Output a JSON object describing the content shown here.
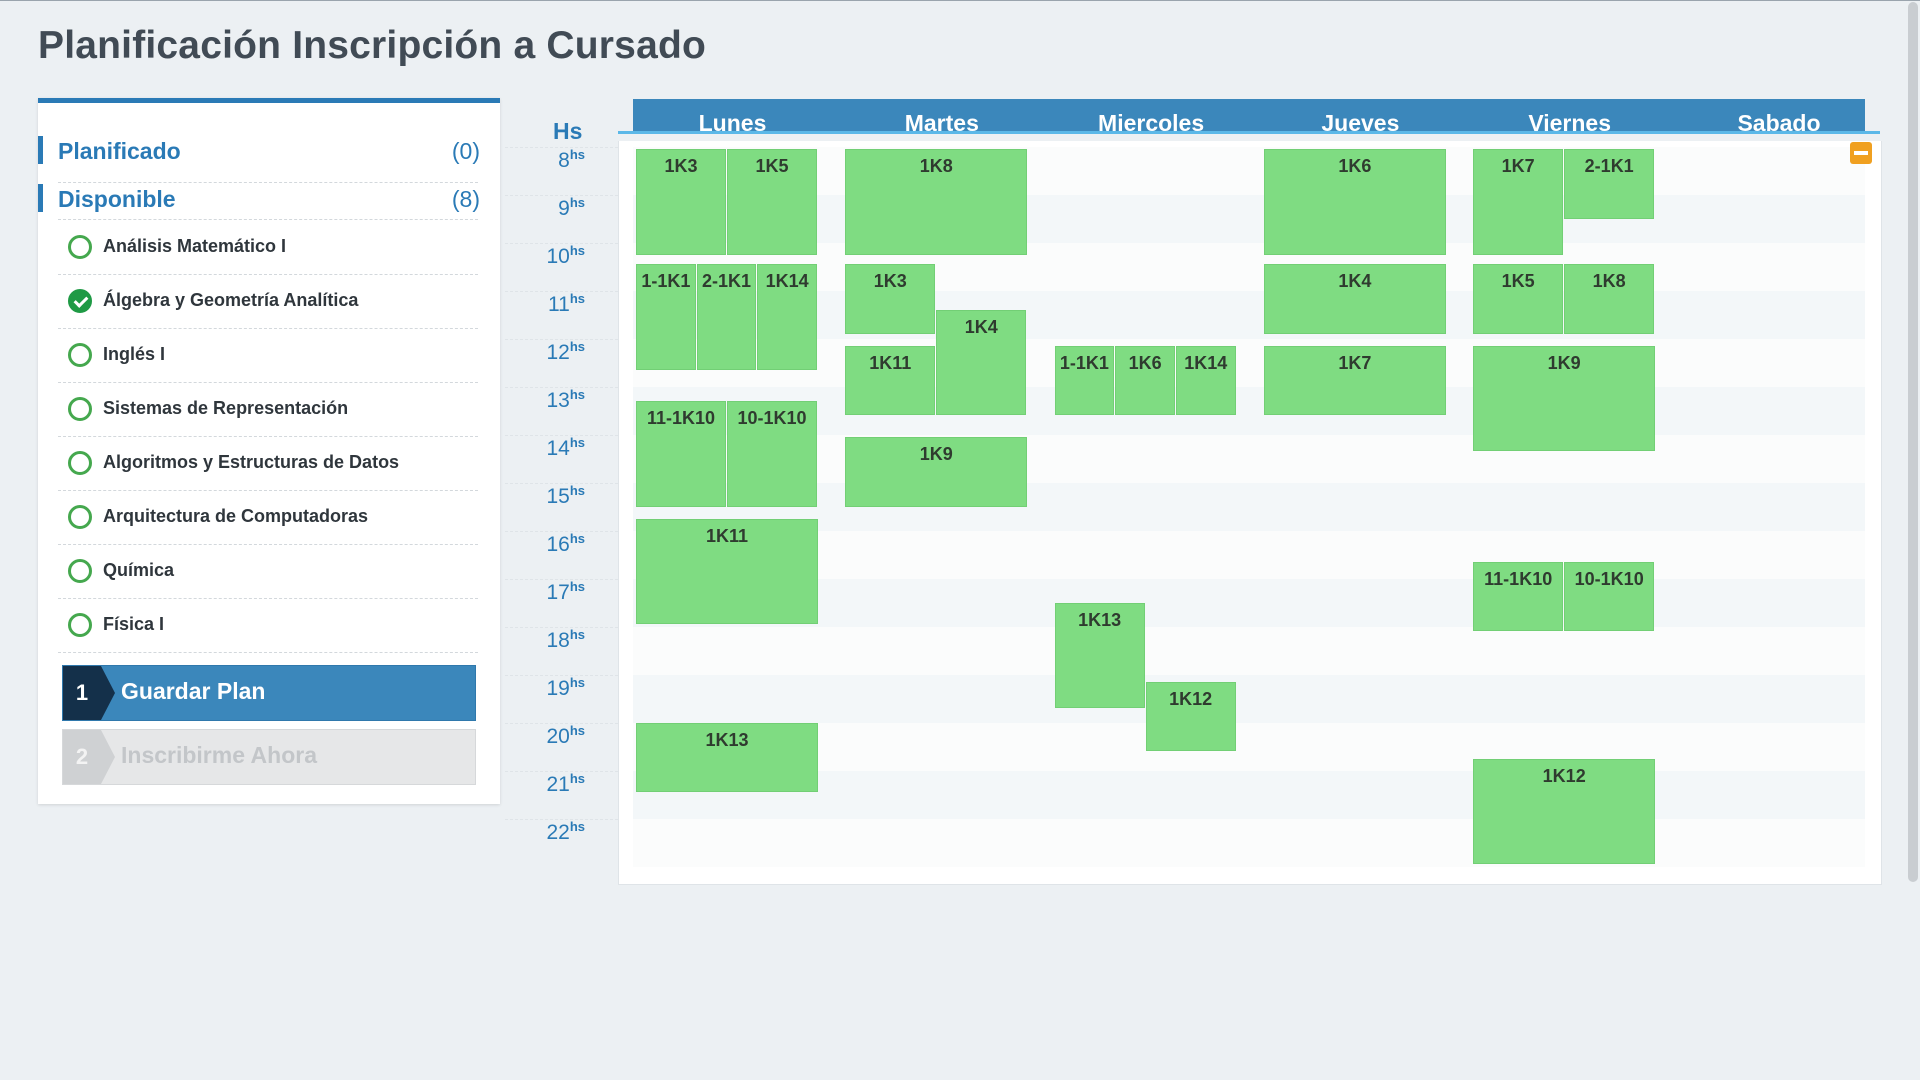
{
  "page": {
    "title": "Planificación Inscripción a Cursado"
  },
  "sidebar": {
    "planned": {
      "label": "Planificado",
      "count": "(0)"
    },
    "available": {
      "label": "Disponible",
      "count": "(8)"
    },
    "subjects": [
      {
        "label": "Análisis Matemático I",
        "checked": false
      },
      {
        "label": "Álgebra y Geometría Analítica",
        "checked": true
      },
      {
        "label": "Inglés I",
        "checked": false
      },
      {
        "label": "Sistemas de Representación",
        "checked": false
      },
      {
        "label": "Algoritmos y Estructuras de Datos",
        "checked": false
      },
      {
        "label": "Arquitectura de Computadoras",
        "checked": false
      },
      {
        "label": "Química",
        "checked": false
      },
      {
        "label": "Física I",
        "checked": false
      }
    ],
    "steps": [
      {
        "number": "1",
        "label": "Guardar Plan",
        "enabled": true
      },
      {
        "number": "2",
        "label": "Inscribirme Ahora",
        "enabled": false
      }
    ]
  },
  "calendar": {
    "hours_label": "Hs",
    "hour_suffix": "hs",
    "days": [
      "Lunes",
      "Martes",
      "Miercoles",
      "Jueves",
      "Viernes",
      "Sabado"
    ],
    "hours": [
      "8",
      "9",
      "10",
      "11",
      "12",
      "13",
      "14",
      "15",
      "16",
      "17",
      "18",
      "19",
      "20",
      "21",
      "22"
    ],
    "blocks": [
      {
        "label": "1K3",
        "day": "Lunes",
        "start": 8,
        "end": 10.2,
        "col": 0,
        "cols": 2
      },
      {
        "label": "1K5",
        "day": "Lunes",
        "start": 8,
        "end": 10.2,
        "col": 1,
        "cols": 2
      },
      {
        "label": "1-1K1",
        "day": "Lunes",
        "start": 10.4,
        "end": 12.6,
        "col": 0,
        "cols": 3
      },
      {
        "label": "2-1K1",
        "day": "Lunes",
        "start": 10.4,
        "end": 12.6,
        "col": 1,
        "cols": 3
      },
      {
        "label": "1K14",
        "day": "Lunes",
        "start": 10.4,
        "end": 12.6,
        "col": 2,
        "cols": 3
      },
      {
        "label": "11-1K10",
        "day": "Lunes",
        "start": 13.25,
        "end": 15.45,
        "col": 0,
        "cols": 2
      },
      {
        "label": "10-1K10",
        "day": "Lunes",
        "start": 13.25,
        "end": 15.45,
        "col": 1,
        "cols": 2
      },
      {
        "label": "1K11",
        "day": "Lunes",
        "start": 15.7,
        "end": 17.9,
        "col": 0,
        "cols": 1
      },
      {
        "label": "1K13",
        "day": "Lunes",
        "start": 19.95,
        "end": 21.4,
        "col": 0,
        "cols": 1
      },
      {
        "label": "1K8",
        "day": "Martes",
        "start": 8,
        "end": 10.2,
        "col": 0,
        "cols": 1
      },
      {
        "label": "1K3",
        "day": "Martes",
        "start": 10.4,
        "end": 11.85,
        "col": 0,
        "cols": 2
      },
      {
        "label": "1K4",
        "day": "Martes",
        "start": 11.35,
        "end": 13.55,
        "col": 1,
        "cols": 2
      },
      {
        "label": "1K11",
        "day": "Martes",
        "start": 12.1,
        "end": 13.55,
        "col": 0,
        "cols": 2
      },
      {
        "label": "1K9",
        "day": "Martes",
        "start": 14.0,
        "end": 15.45,
        "col": 0,
        "cols": 1
      },
      {
        "label": "1-1K1",
        "day": "Miercoles",
        "start": 12.1,
        "end": 13.55,
        "col": 0,
        "cols": 3
      },
      {
        "label": "1K6",
        "day": "Miercoles",
        "start": 12.1,
        "end": 13.55,
        "col": 1,
        "cols": 3
      },
      {
        "label": "1K14",
        "day": "Miercoles",
        "start": 12.1,
        "end": 13.55,
        "col": 2,
        "cols": 3
      },
      {
        "label": "1K13",
        "day": "Miercoles",
        "start": 17.45,
        "end": 19.65,
        "col": 0,
        "cols": 2
      },
      {
        "label": "1K12",
        "day": "Miercoles",
        "start": 19.1,
        "end": 20.55,
        "col": 1,
        "cols": 2
      },
      {
        "label": "1K6",
        "day": "Jueves",
        "start": 8,
        "end": 10.2,
        "col": 0,
        "cols": 1
      },
      {
        "label": "1K4",
        "day": "Jueves",
        "start": 10.4,
        "end": 11.85,
        "col": 0,
        "cols": 1
      },
      {
        "label": "1K7",
        "day": "Jueves",
        "start": 12.1,
        "end": 13.55,
        "col": 0,
        "cols": 1
      },
      {
        "label": "1K7",
        "day": "Viernes",
        "start": 8,
        "end": 10.2,
        "col": 0,
        "cols": 2
      },
      {
        "label": "2-1K1",
        "day": "Viernes",
        "start": 8,
        "end": 9.45,
        "col": 1,
        "cols": 2
      },
      {
        "label": "1K5",
        "day": "Viernes",
        "start": 10.4,
        "end": 11.85,
        "col": 0,
        "cols": 2
      },
      {
        "label": "1K8",
        "day": "Viernes",
        "start": 10.4,
        "end": 11.85,
        "col": 1,
        "cols": 2
      },
      {
        "label": "1K9",
        "day": "Viernes",
        "start": 12.1,
        "end": 14.3,
        "col": 0,
        "cols": 1
      },
      {
        "label": "11-1K10",
        "day": "Viernes",
        "start": 16.6,
        "end": 18.05,
        "col": 0,
        "cols": 2
      },
      {
        "label": "10-1K10",
        "day": "Viernes",
        "start": 16.6,
        "end": 18.05,
        "col": 1,
        "cols": 2
      },
      {
        "label": "1K12",
        "day": "Viernes",
        "start": 20.7,
        "end": 22.9,
        "col": 0,
        "cols": 1
      }
    ]
  },
  "colors": {
    "accent": "#2a7ab6",
    "header": "#3b87bb",
    "block": "#7fdc82",
    "check": "#1f9a45",
    "minimize": "#f0a020"
  }
}
